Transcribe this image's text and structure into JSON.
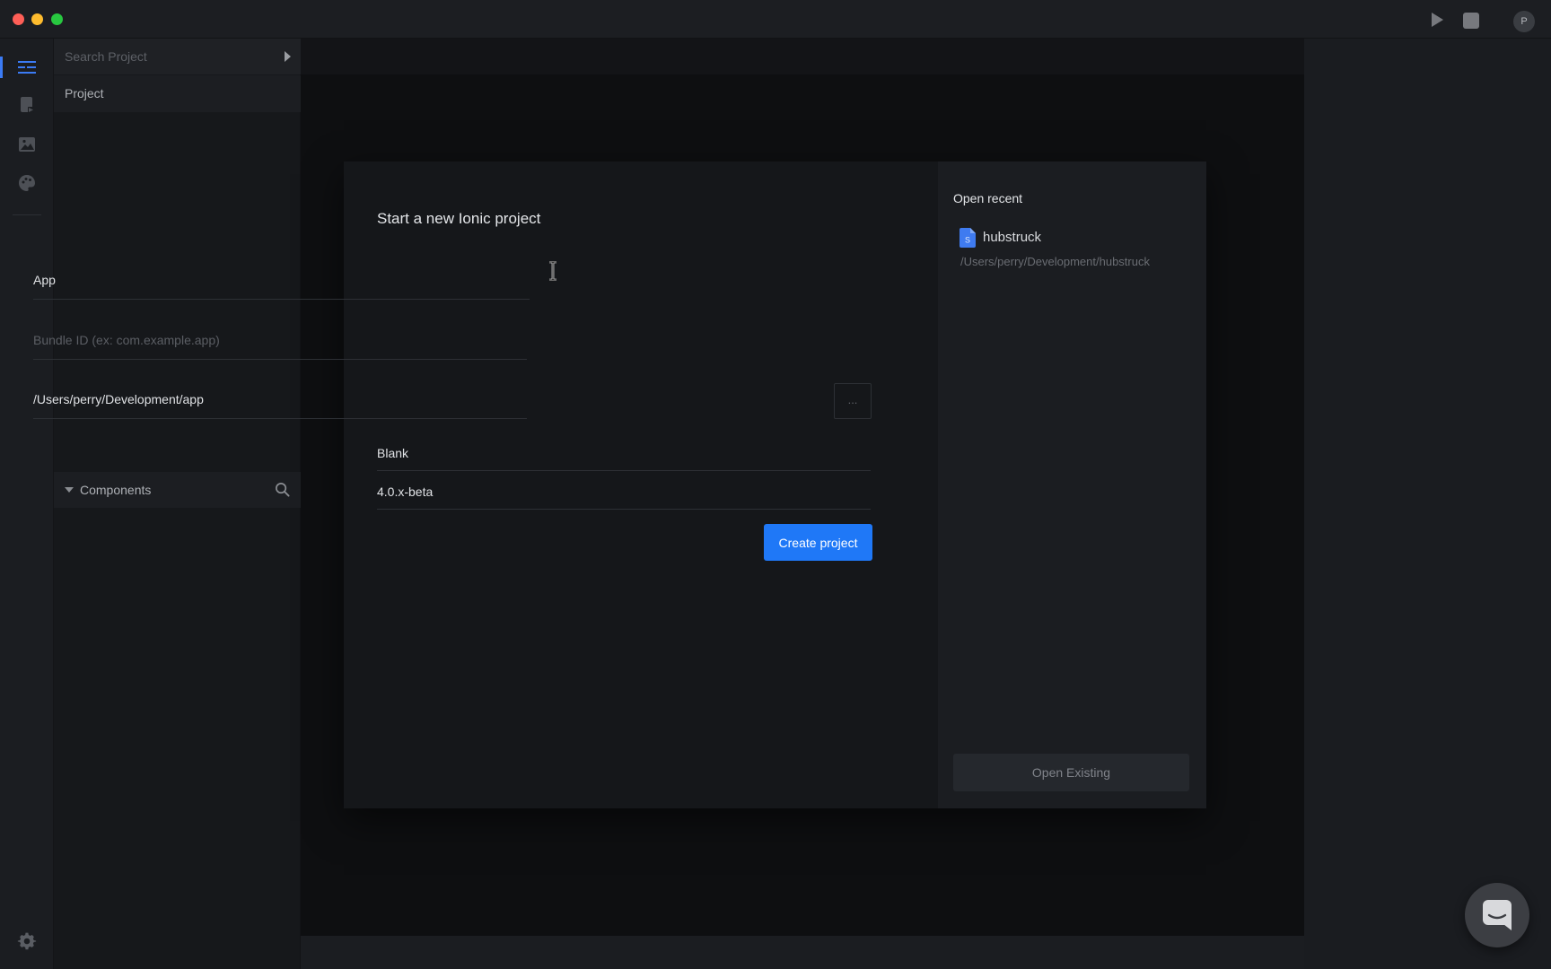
{
  "titlebar": {
    "avatar_initial": "P"
  },
  "sidebar": {
    "search_placeholder": "Search Project",
    "project_label": "Project",
    "components_label": "Components"
  },
  "modal": {
    "title": "Start a new Ionic project",
    "app_name_value": "App",
    "bundle_id_placeholder": "Bundle ID (ex: com.example.app)",
    "path_value": "/Users/perry/Development/app",
    "browse_label": "...",
    "template_value": "Blank",
    "version_value": "4.0.x-beta",
    "create_label": "Create project",
    "recent": {
      "title": "Open recent",
      "items": [
        {
          "name": "hubstruck",
          "path": "/Users/perry/Development/hubstruck",
          "icon": "file-icon",
          "icon_letter": "S"
        }
      ]
    },
    "open_existing_label": "Open Existing"
  },
  "colors": {
    "accent": "#1f78f7",
    "active_indicator": "#3b7bf5",
    "file_icon": "#3f7bf0",
    "traffic_red": "#fe5f57",
    "traffic_yellow": "#febc2e",
    "traffic_green": "#28c840"
  },
  "icons": {
    "rail": [
      "project-tree-icon",
      "pages-icon",
      "image-icon",
      "palette-icon"
    ],
    "settings": "gear-icon",
    "run": "play-icon",
    "stop": "stop-icon",
    "chat": "chat-icon"
  }
}
